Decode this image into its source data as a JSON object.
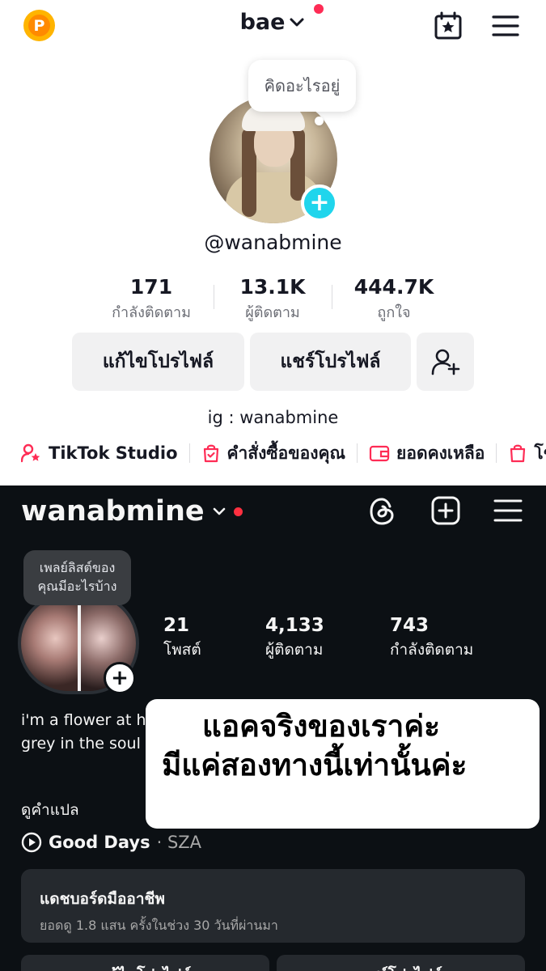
{
  "tiktok": {
    "coin_label": "P",
    "username": "bae",
    "thought_bubble": "คิดอะไรอยู่",
    "handle": "@wanabmine",
    "stats": [
      {
        "value": "171",
        "label": "กำลังติดตาม"
      },
      {
        "value": "13.1K",
        "label": "ผู้ติดตาม"
      },
      {
        "value": "444.7K",
        "label": "ถูกใจ"
      }
    ],
    "buttons": {
      "edit_profile": "แก้ไขโปรไฟล์",
      "share_profile": "แชร์โปรไฟล์"
    },
    "bio": "ig : wanabmine",
    "links": [
      {
        "label": "TikTok Studio"
      },
      {
        "label": "คำสั่งซื้อของคุณ"
      },
      {
        "label": "ยอดคงเหลือ"
      },
      {
        "label": "โช"
      }
    ],
    "colors": {
      "accent": "#fe2c55",
      "plus": "#20d5ec"
    }
  },
  "instagram": {
    "username": "wanabmine",
    "note_bubble": [
      "เพลย์ลิสต์ของ",
      "คุณมีอะไรบ้าง"
    ],
    "stats": [
      {
        "value": "21",
        "label": "โพสต์"
      },
      {
        "value": "4,133",
        "label": "ผู้ติดตาม"
      },
      {
        "value": "743",
        "label": "กำลังติดตาม"
      }
    ],
    "bio_lines": [
      "i'm a flower at heart",
      "grey in the soul"
    ],
    "translate": "ดูคำแปล",
    "music": {
      "song": "Good Days",
      "artist": "· SZA"
    },
    "dashboard": {
      "title": "แดชบอร์ดมืออาชีพ",
      "subtitle": "ยอดดู 1.8 แสน ครั้งในช่วง 30 วันที่ผ่านมา"
    },
    "buttons": [
      "แก้ไขโปรไฟล์",
      "แชร์โปรไฟล์"
    ]
  },
  "overlay_caption": [
    "แอคจริงของเราค่ะ",
    "มีแค่สองทางนี้เท่านั้นค่ะ"
  ]
}
